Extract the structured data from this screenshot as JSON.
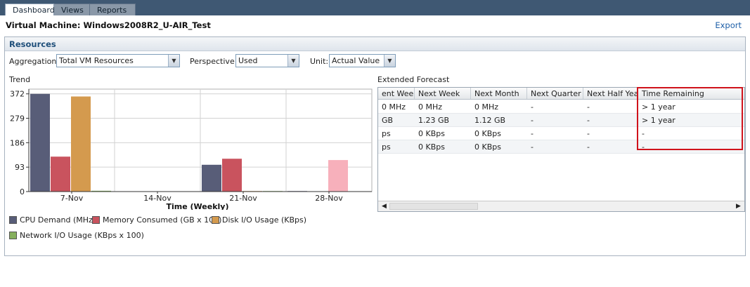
{
  "tabs": [
    {
      "label": "Dashboard",
      "active": true
    },
    {
      "label": "Views",
      "active": false
    },
    {
      "label": "Reports",
      "active": false
    }
  ],
  "vm_title": "Virtual Machine: Windows2008R2_U-AIR_Test",
  "export_label": "Export",
  "panel_title": "Resources",
  "controls": {
    "aggregation_label": "Aggregation:",
    "aggregation_value": "Total VM Resources",
    "perspective_label": "Perspective:",
    "perspective_value": "Used",
    "unit_label": "Unit:",
    "unit_value": "Actual Value"
  },
  "trend_label": "Trend",
  "chart_data": {
    "type": "bar",
    "categories": [
      "7-Nov",
      "14-Nov",
      "21-Nov",
      "28-Nov"
    ],
    "xlabel": "Time (Weekly)",
    "ylabel": "",
    "yticks": [
      "0",
      "93",
      "186",
      "279",
      "372"
    ],
    "ylim": [
      0,
      390
    ],
    "grid": true,
    "series": [
      {
        "name": "CPU Demand (MHz)",
        "color": "#585d78",
        "values": [
          372,
          0,
          102,
          2
        ]
      },
      {
        "name": "Memory Consumed (GB x 100)",
        "color": "#c9535e",
        "values": [
          133,
          0,
          125,
          0
        ]
      },
      {
        "name": "Disk I/O Usage (KBps)",
        "color": "#d49a4e",
        "values": [
          362,
          0,
          2,
          120
        ]
      },
      {
        "name": "Network I/O Usage (KBps x 100)",
        "color": "#86b05e",
        "values": [
          3,
          0,
          2,
          0
        ]
      }
    ],
    "series_colors_special": {
      "28-Nov": {
        "Disk I/O Usage (KBps)": "#f7b0bb"
      }
    }
  },
  "forecast_label": "Extended Forecast",
  "forecast": {
    "columns": [
      "ent Week",
      "Next Week",
      "Next Month",
      "Next Quarter",
      "Next Half Year",
      "Time Remaining"
    ],
    "rows": [
      [
        "0 MHz",
        "0 MHz",
        "0 MHz",
        "-",
        "-",
        "> 1 year"
      ],
      [
        "GB",
        "1.23 GB",
        "1.12 GB",
        "-",
        "-",
        "> 1 year"
      ],
      [
        "ps",
        "0 KBps",
        "0 KBps",
        "-",
        "-",
        "-"
      ],
      [
        "ps",
        "0 KBps",
        "0 KBps",
        "-",
        "-",
        "-"
      ]
    ]
  },
  "colors": {
    "header_bar": "#3f5873",
    "highlight": "#d0121b",
    "link": "#1e5fa8"
  }
}
